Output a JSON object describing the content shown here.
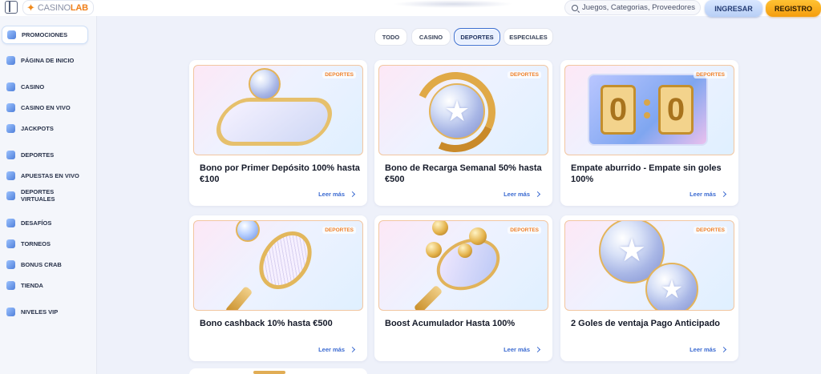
{
  "header": {
    "logo_prefix": "CASINO",
    "logo_suffix": "LAB",
    "search_placeholder": "Juegos, Categorias, Proveedores",
    "login_label": "INGRESAR",
    "register_label": "REGISTRO"
  },
  "sidebar": {
    "items": [
      {
        "label": "PROMOCIONES",
        "icon": "gift-icon",
        "active": true
      },
      {
        "label": "PÁGINA DE INICIO",
        "icon": "home-icon"
      },
      {
        "label": "CASINO",
        "icon": "casino-chip-icon"
      },
      {
        "label": "CASINO EN VIVO",
        "icon": "live-camera-icon"
      },
      {
        "label": "JACKPOTS",
        "icon": "jackpot-icon"
      },
      {
        "label": "DEPORTES",
        "icon": "sports-icon"
      },
      {
        "label": "APUESTAS EN VIVO",
        "icon": "live-bets-icon"
      },
      {
        "label": "DEPORTES VIRTUALES",
        "icon": "virtual-sports-icon"
      },
      {
        "label": "DESAFÍOS",
        "icon": "challenges-icon"
      },
      {
        "label": "TORNEOS",
        "icon": "trophy-icon"
      },
      {
        "label": "BONUS CRAB",
        "icon": "crab-icon"
      },
      {
        "label": "TIENDA",
        "icon": "shop-icon"
      },
      {
        "label": "NIVELES VIP",
        "icon": "crown-icon"
      }
    ]
  },
  "tabs": [
    {
      "label": "TODO"
    },
    {
      "label": "CASINO"
    },
    {
      "label": "DEPORTES",
      "active": true
    },
    {
      "label": "ESPECIALES"
    }
  ],
  "cards": [
    {
      "badge": "DEPORTES",
      "title": "Bono por Primer Depósito 100% hasta €100",
      "link": "Leer más",
      "art": "stadium-ball"
    },
    {
      "badge": "DEPORTES",
      "title": "Bono de Recarga Semanal 50% hasta €500",
      "link": "Leer más",
      "art": "ball-arrows"
    },
    {
      "badge": "DEPORTES",
      "title": "Empate aburrido - Empate sin goles 100%",
      "link": "Leer más",
      "art": "scoreboard",
      "score": [
        "0",
        "0"
      ]
    },
    {
      "badge": "DEPORTES",
      "title": "Bono cashback 10% hasta €500",
      "link": "Leer más",
      "art": "tennis-racket"
    },
    {
      "badge": "DEPORTES",
      "title": "Boost Acumulador Hasta 100%",
      "link": "Leer más",
      "art": "ping-pong"
    },
    {
      "badge": "DEPORTES",
      "title": "2 Goles de ventaja Pago Anticipado",
      "link": "Leer más",
      "art": "two-balls"
    }
  ]
}
